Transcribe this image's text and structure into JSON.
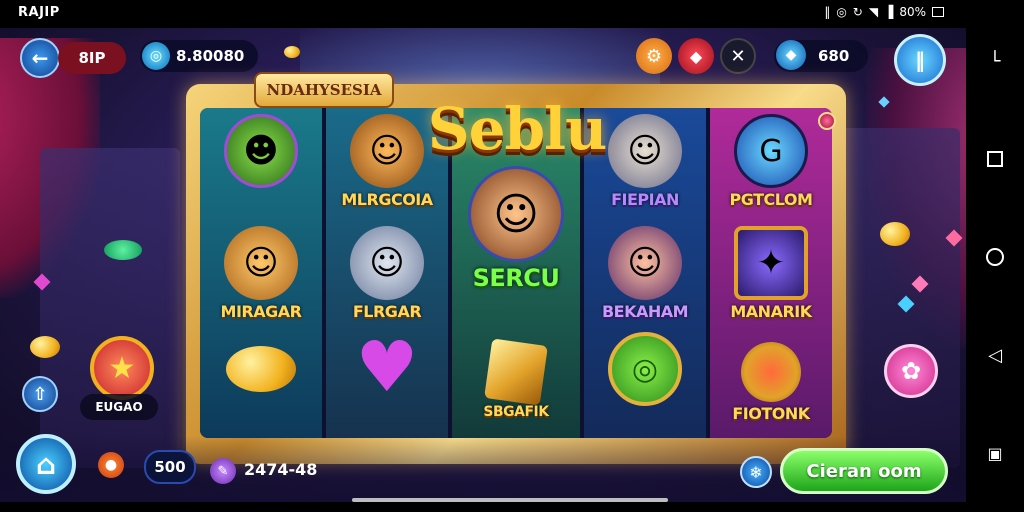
{
  "status_bar": {
    "left_text": "RAJIP",
    "right_text": "80%"
  },
  "hud": {
    "back_icon": "back-arrow-icon",
    "player_label": "8IP",
    "coin_balance": "8.80080",
    "gem_balance": "680",
    "colors": {
      "accent": "#2a8fe0",
      "red": "#c8222e",
      "orange": "#f08a1a"
    }
  },
  "game": {
    "title_plaque": "NDAHYSESIA",
    "logo": "Sebl",
    "logo_suffix": "u",
    "reels": [
      {
        "symbols": [
          {
            "icon": "goblin-icon",
            "label": ""
          },
          {
            "icon": "cowboy-icon",
            "label": "MIRAGAR"
          },
          {
            "icon": "coin-icon",
            "label": ""
          }
        ]
      },
      {
        "symbols": [
          {
            "icon": "cowboy-icon",
            "label": "MLRGCOIA"
          },
          {
            "icon": "knight-icon",
            "label": "FLRGAR"
          },
          {
            "icon": "heart-icon",
            "label": ""
          }
        ]
      },
      {
        "symbols": [
          {
            "icon": "hero-cowboy-icon",
            "label": "SERCU"
          },
          {
            "icon": "gold-gem-icon",
            "label": "SBGAFIK"
          }
        ]
      },
      {
        "symbols": [
          {
            "icon": "elf-icon",
            "label": "FIEPIAN"
          },
          {
            "icon": "cowboy-icon",
            "label": "BEKAHAM"
          },
          {
            "icon": "coin-icon",
            "label": ""
          }
        ]
      },
      {
        "symbols": [
          {
            "icon": "rune-ring-icon",
            "label": "PGTCLOM"
          },
          {
            "icon": "portal-icon",
            "label": "MANARIK"
          },
          {
            "icon": "medal-icon",
            "label": "FIOTONK"
          }
        ]
      }
    ]
  },
  "left_panel": {
    "bonus_label": "EUGAO"
  },
  "bottom": {
    "bet_value": "500",
    "win_value": "2474-48",
    "spin_label": "Cieran oom"
  }
}
